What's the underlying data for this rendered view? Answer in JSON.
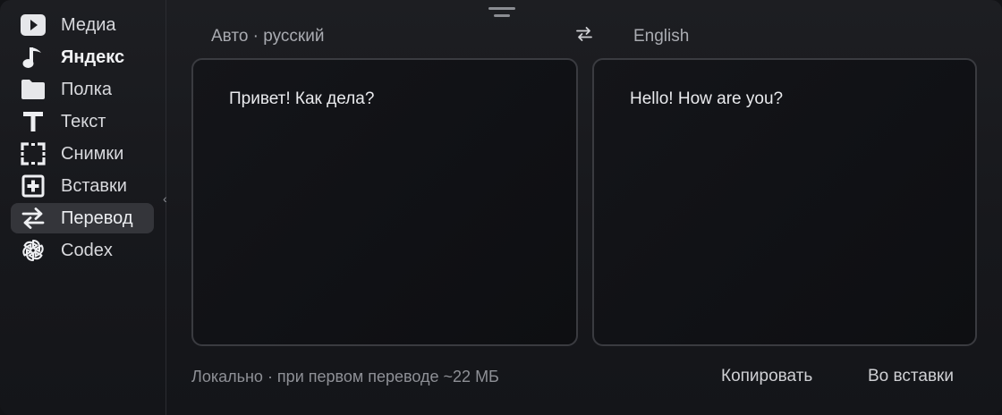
{
  "sidebar": {
    "items": [
      {
        "label": "Медиа",
        "icon": "play-icon"
      },
      {
        "label": "Яндекс",
        "icon": "music-note-icon"
      },
      {
        "label": "Полка",
        "icon": "folder-icon"
      },
      {
        "label": "Текст",
        "icon": "text-t-icon"
      },
      {
        "label": "Снимки",
        "icon": "screenshot-frame-icon"
      },
      {
        "label": "Вставки",
        "icon": "plus-square-icon"
      },
      {
        "label": "Перевод",
        "icon": "swap-arrows-icon"
      },
      {
        "label": "Codex",
        "icon": "openai-logo-icon"
      }
    ],
    "active_index": 6,
    "collapse_glyph": "‹"
  },
  "translator": {
    "source_lang": "Авто · русский",
    "target_lang": "English",
    "swap_icon": "swap-arrows-icon",
    "source_text": "Привет! Как дела?",
    "target_text": "Hello! How are you?"
  },
  "footer": {
    "note": "Локально · при первом переводе ~22 МБ",
    "copy_label": "Копировать",
    "insert_label": "Во вставки"
  },
  "colors": {
    "background": "#17181c",
    "active_item": "#34353a",
    "panel_border": "#3a3b40",
    "text_primary": "#e9eaed",
    "text_muted": "#8e9096"
  }
}
